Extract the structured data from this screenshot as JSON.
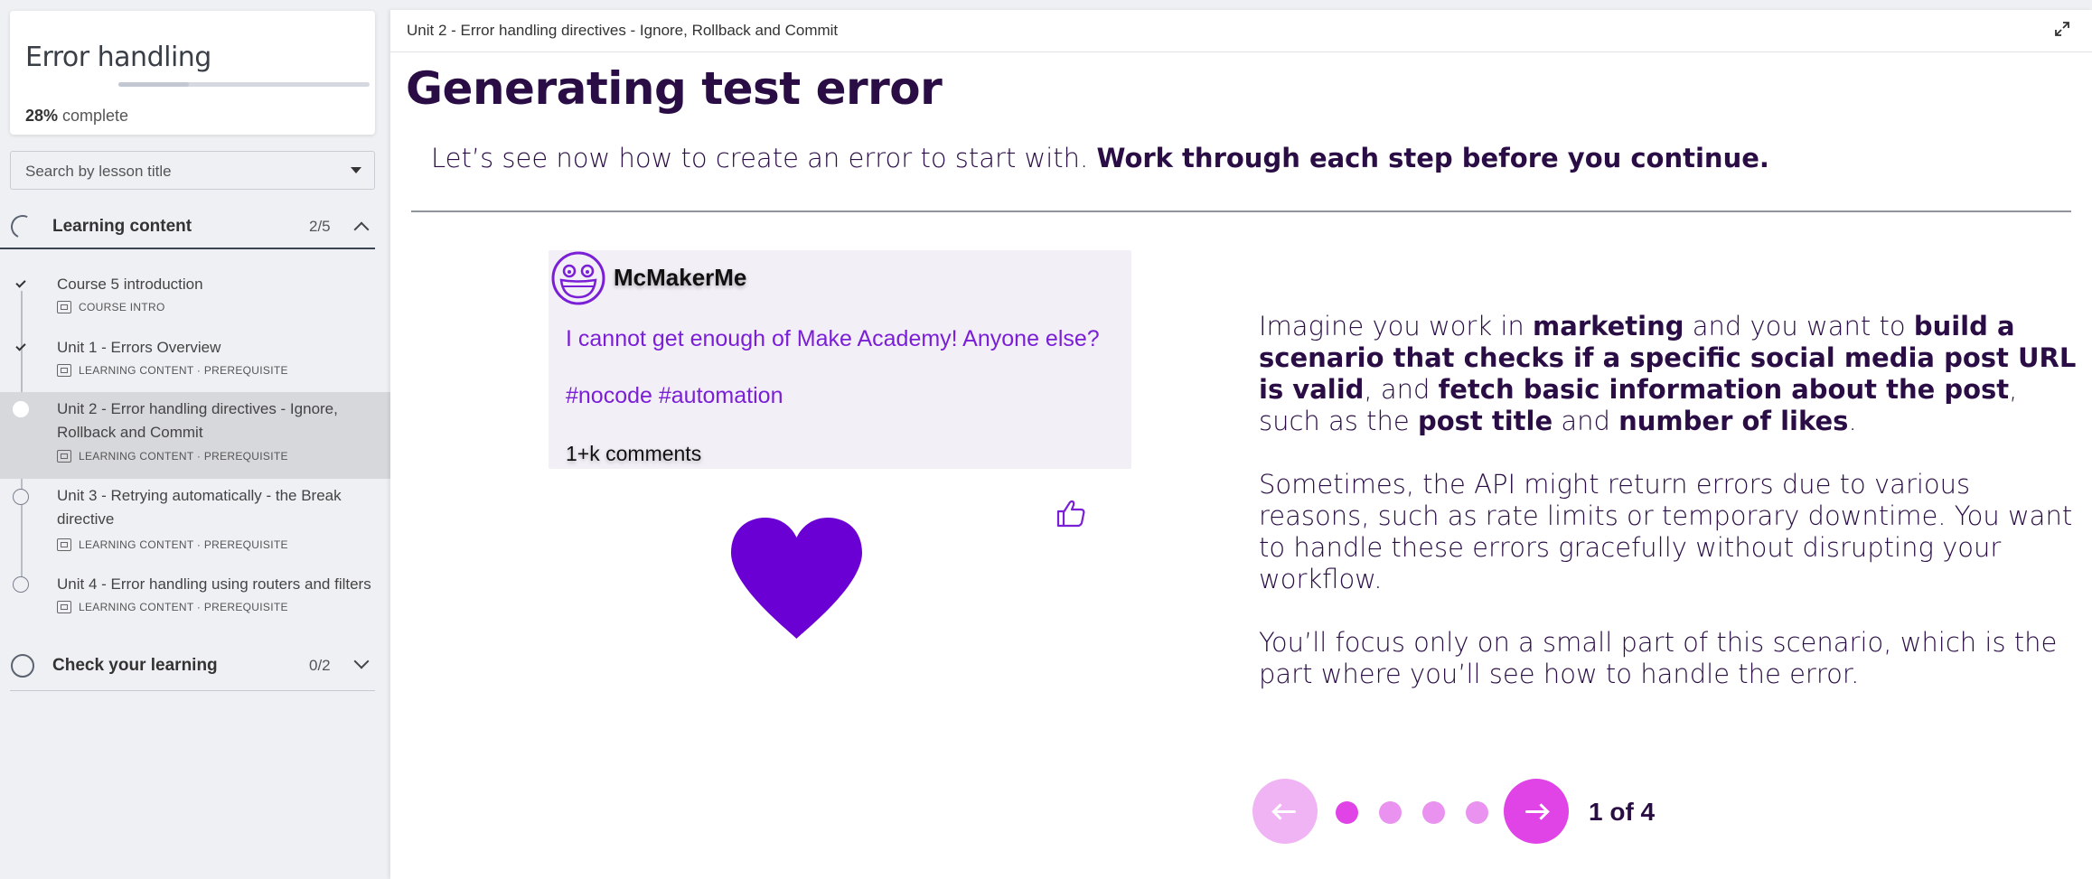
{
  "sidebar": {
    "course_title": "Error handling",
    "progress_percent": "28%",
    "progress_value": 0.28,
    "progress_suffix": " complete",
    "search_placeholder": "Search by lesson title",
    "sections": [
      {
        "title": "Learning content",
        "count": "2/5",
        "expanded": true
      },
      {
        "title": "Check your learning",
        "count": "0/2",
        "expanded": false
      }
    ],
    "lessons": [
      {
        "title": "Course 5 introduction",
        "meta": "COURSE INTRO",
        "status": "complete"
      },
      {
        "title": "Unit 1 - Errors Overview",
        "meta": "LEARNING CONTENT · PREREQUISITE",
        "status": "complete"
      },
      {
        "title": "Unit 2 - Error handling directives - Ignore, Rollback and Commit",
        "meta": "LEARNING CONTENT · PREREQUISITE",
        "status": "active"
      },
      {
        "title": "Unit 3 - Retrying automatically - the Break directive",
        "meta": "LEARNING CONTENT · PREREQUISITE",
        "status": "incomplete"
      },
      {
        "title": "Unit 4 - Error handling using routers and filters",
        "meta": "LEARNING CONTENT · PREREQUISITE",
        "status": "incomplete"
      }
    ]
  },
  "main": {
    "breadcrumb": "Unit 2 - Error handling directives - Ignore, Rollback and Commit",
    "title": "Generating test error",
    "intro_plain": "Let’s see now how to create an error to start with. ",
    "intro_bold": "Work through each step before you continue.",
    "post": {
      "username": "McMakerMe",
      "text": "I cannot get enough of Make Academy! Anyone else?",
      "tags": "#nocode #automation",
      "comments": "1+k comments"
    },
    "description": {
      "p1": [
        {
          "t": "Imagine you work in ",
          "b": false
        },
        {
          "t": "marketing",
          "b": true
        },
        {
          "t": " and you want to ",
          "b": false
        },
        {
          "t": "build a scenario that checks if a specific social media post URL is valid",
          "b": true
        },
        {
          "t": ", and ",
          "b": false
        },
        {
          "t": "fetch basic information about the post",
          "b": true
        },
        {
          "t": ", such as the ",
          "b": false
        },
        {
          "t": "post title",
          "b": true
        },
        {
          "t": " and ",
          "b": false
        },
        {
          "t": "number of likes",
          "b": true
        },
        {
          "t": ".",
          "b": false
        }
      ],
      "p2": "Sometimes, the API might return errors due to various reasons, such as rate limits or temporary downtime. You want to handle these errors gracefully without disrupting your workflow.",
      "p3": "You’ll focus only on a small part of this scenario, which is the part where you’ll see how to handle the error."
    },
    "pager": {
      "label": "1 of 4",
      "current": 1,
      "total": 4
    }
  },
  "colors": {
    "accent": "#e044e6",
    "accent_light": "#f0b3f3",
    "heading": "#2a0d45",
    "post_text": "#7a1fd6",
    "heart": "#6a00d4"
  }
}
